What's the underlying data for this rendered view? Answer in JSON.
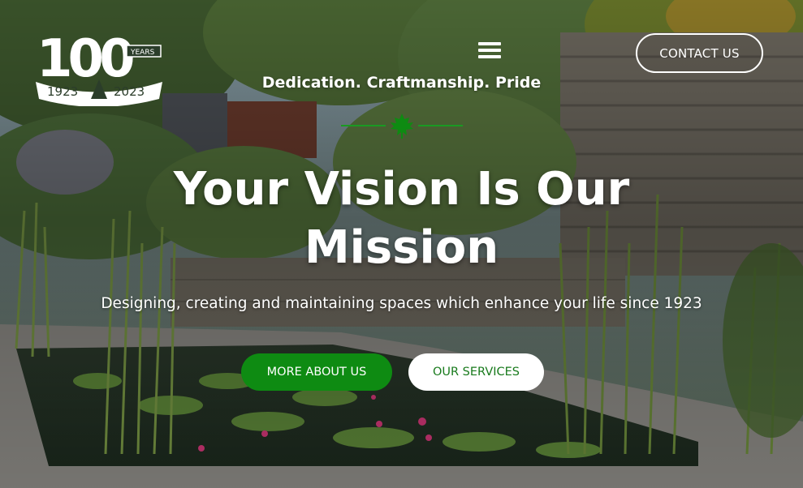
{
  "logo": {
    "big_number": "100",
    "years_label": "YEARS",
    "year_start": "1923",
    "year_end": "2023"
  },
  "header": {
    "menu_icon": "hamburger-menu-icon",
    "contact_label": "CONTACT US",
    "tagline": "Dedication. Craftmanship. Pride",
    "divider_icon": "maple-leaf-icon"
  },
  "hero": {
    "headline_line1": "Your Vision Is Our",
    "headline_line2": "Mission",
    "subtitle": "Designing, creating and maintaining spaces which enhance your life since 1923",
    "primary_button": "MORE ABOUT US",
    "secondary_button": "OUR SERVICES"
  },
  "colors": {
    "brand_green": "#0e8b12",
    "secondary_text_green": "#187a1c",
    "text": "#ffffff"
  }
}
